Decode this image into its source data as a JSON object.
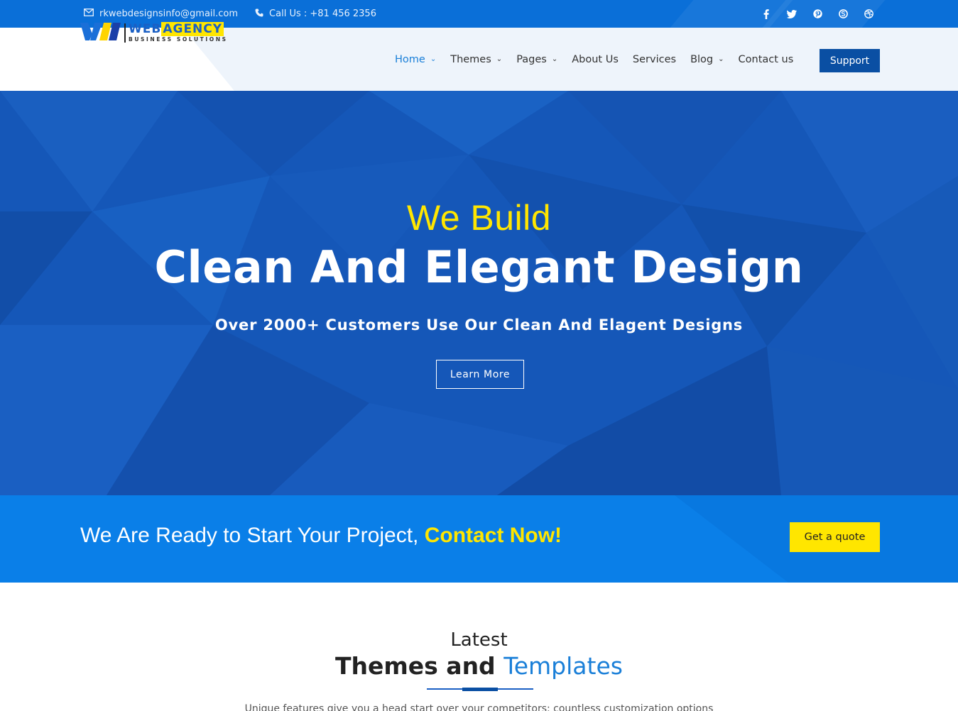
{
  "topbar": {
    "email": "rkwebdesignsinfo@gmail.com",
    "phone": "Call Us : +81 456 2356",
    "social": [
      "facebook-icon",
      "twitter-icon",
      "pinterest-icon",
      "skype-icon",
      "dribbble-icon"
    ]
  },
  "header": {
    "logo": {
      "web": "WEB",
      "agency": "AGENCY",
      "tagline": "BUSINESS SOLUTIONS"
    },
    "nav": [
      {
        "label": "Home",
        "dropdown": true,
        "active": true
      },
      {
        "label": "Themes",
        "dropdown": true
      },
      {
        "label": "Pages",
        "dropdown": true
      },
      {
        "label": "About Us",
        "dropdown": false
      },
      {
        "label": "Services",
        "dropdown": false
      },
      {
        "label": "Blog",
        "dropdown": true
      },
      {
        "label": "Contact us",
        "dropdown": false
      }
    ],
    "support_label": "Support"
  },
  "hero": {
    "kicker": "We Build",
    "title": "Clean And Elegant Design",
    "subtitle": "Over 2000+ Customers Use Our Clean And Elagent Designs",
    "button_label": "Learn More"
  },
  "cta": {
    "text": "We Are Ready to Start Your Project,",
    "highlight": "Contact Now!",
    "button_label": "Get a quote"
  },
  "section": {
    "kicker": "Latest",
    "title_main": "Themes and",
    "title_accent": "Templates",
    "description": "Unique features give you a head start over your competitors: countless customization options"
  },
  "colors": {
    "topbar": "#0a6fd8",
    "hero": "#1557b8",
    "cta": "#0a7fe8",
    "accent_yellow": "#ffe600",
    "support_button": "#0a4fa3"
  }
}
